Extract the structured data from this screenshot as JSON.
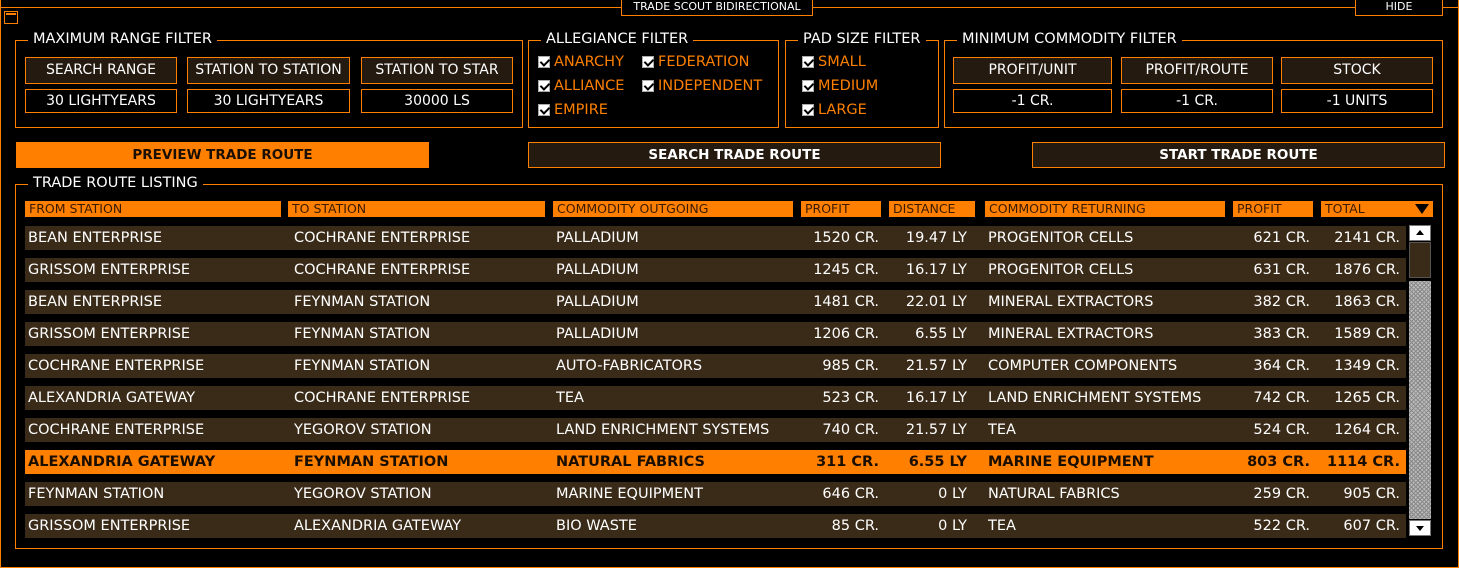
{
  "window": {
    "title": "TRADE SCOUT BIDIRECTIONAL",
    "hide_label": "HIDE"
  },
  "range_filter": {
    "title": "MAXIMUM RANGE FILTER",
    "buttons": [
      "SEARCH RANGE",
      "STATION TO STATION",
      "STATION TO STAR"
    ],
    "values": [
      "30 LIGHTYEARS",
      "30 LIGHTYEARS",
      "30000 LS"
    ]
  },
  "allegiance_filter": {
    "title": "ALLEGIANCE FILTER",
    "options": [
      {
        "label": "ANARCHY",
        "checked": true
      },
      {
        "label": "FEDERATION",
        "checked": true
      },
      {
        "label": "ALLIANCE",
        "checked": true
      },
      {
        "label": "INDEPENDENT",
        "checked": true
      },
      {
        "label": "EMPIRE",
        "checked": true
      }
    ]
  },
  "pad_filter": {
    "title": "PAD SIZE FILTER",
    "options": [
      {
        "label": "SMALL",
        "checked": true
      },
      {
        "label": "MEDIUM",
        "checked": true
      },
      {
        "label": "LARGE",
        "checked": true
      }
    ]
  },
  "commodity_filter": {
    "title": "MINIMUM COMMODITY FILTER",
    "buttons": [
      "PROFIT/UNIT",
      "PROFIT/ROUTE",
      "STOCK"
    ],
    "values": [
      "-1 CR.",
      "-1 CR.",
      "-1 UNITS"
    ]
  },
  "actions": {
    "preview": "PREVIEW TRADE ROUTE",
    "search": "SEARCH TRADE ROUTE",
    "start": "START TRADE ROUTE"
  },
  "listing": {
    "title": "TRADE ROUTE LISTING",
    "columns": [
      "FROM STATION",
      "TO STATION",
      "COMMODITY OUTGOING",
      "PROFIT",
      "DISTANCE",
      "COMMODITY RETURNING",
      "PROFIT",
      "TOTAL"
    ],
    "selected_index": 7,
    "rows": [
      [
        "BEAN ENTERPRISE",
        "COCHRANE ENTERPRISE",
        "PALLADIUM",
        "1520 CR.",
        "19.47 LY",
        "PROGENITOR CELLS",
        "621 CR.",
        "2141 CR."
      ],
      [
        "GRISSOM ENTERPRISE",
        "COCHRANE ENTERPRISE",
        "PALLADIUM",
        "1245 CR.",
        "16.17 LY",
        "PROGENITOR CELLS",
        "631 CR.",
        "1876 CR."
      ],
      [
        "BEAN ENTERPRISE",
        "FEYNMAN STATION",
        "PALLADIUM",
        "1481 CR.",
        "22.01 LY",
        "MINERAL EXTRACTORS",
        "382 CR.",
        "1863 CR."
      ],
      [
        "GRISSOM ENTERPRISE",
        "FEYNMAN STATION",
        "PALLADIUM",
        "1206 CR.",
        "6.55 LY",
        "MINERAL EXTRACTORS",
        "383 CR.",
        "1589 CR."
      ],
      [
        "COCHRANE ENTERPRISE",
        "FEYNMAN STATION",
        "AUTO-FABRICATORS",
        "985 CR.",
        "21.57 LY",
        "COMPUTER COMPONENTS",
        "364 CR.",
        "1349 CR."
      ],
      [
        "ALEXANDRIA GATEWAY",
        "COCHRANE ENTERPRISE",
        "TEA",
        "523 CR.",
        "16.17 LY",
        "LAND ENRICHMENT SYSTEMS",
        "742 CR.",
        "1265 CR."
      ],
      [
        "COCHRANE ENTERPRISE",
        "YEGOROV STATION",
        "LAND ENRICHMENT SYSTEMS",
        "740 CR.",
        "21.57 LY",
        "TEA",
        "524 CR.",
        "1264 CR."
      ],
      [
        "ALEXANDRIA GATEWAY",
        "FEYNMAN STATION",
        "NATURAL FABRICS",
        "311 CR.",
        "6.55 LY",
        "MARINE EQUIPMENT",
        "803 CR.",
        "1114 CR."
      ],
      [
        "FEYNMAN STATION",
        "YEGOROV STATION",
        "MARINE EQUIPMENT",
        "646 CR.",
        "0 LY",
        "NATURAL FABRICS",
        "259 CR.",
        "905 CR."
      ],
      [
        "GRISSOM ENTERPRISE",
        "ALEXANDRIA GATEWAY",
        "BIO WASTE",
        "85 CR.",
        "0 LY",
        "TEA",
        "522 CR.",
        "607 CR."
      ]
    ]
  },
  "colors": {
    "accent": "#ff8000",
    "row_bg": "#3a2a18",
    "background": "#000000"
  },
  "icons": {
    "window": "window-icon",
    "sort": "sort-down-icon",
    "scroll_up": "scroll-up-icon",
    "scroll_down": "scroll-down-icon"
  }
}
